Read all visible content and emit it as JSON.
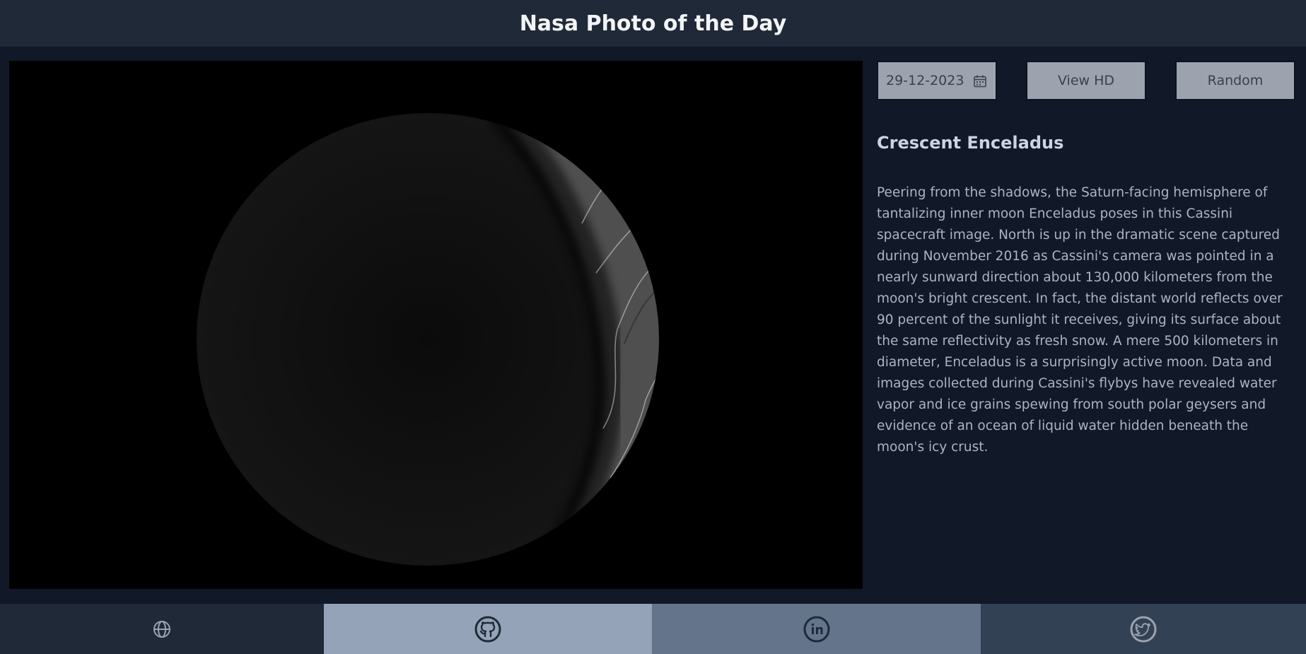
{
  "header": {
    "title": "Nasa Photo of the Day"
  },
  "controls": {
    "date_value": "29-12-2023",
    "view_hd_label": "View HD",
    "random_label": "Random"
  },
  "photo": {
    "title": "Crescent Enceladus",
    "description": "Peering from the shadows, the Saturn-facing hemisphere of tantalizing inner moon Enceladus poses in this Cassini spacecraft image. North is up in the dramatic scene captured during November 2016 as Cassini's camera was pointed in a nearly sunward direction about 130,000 kilometers from the moon's bright crescent. In fact, the distant world reflects over 90 percent of the sunlight it receives, giving its surface about the same reflectivity as fresh snow. A mere 500 kilometers in diameter, Enceladus is a surprisingly active moon. Data and images collected during Cassini's flybys have revealed water vapor and ice grains spewing from south polar geysers and evidence of an ocean of liquid water hidden beneath the moon's icy crust."
  },
  "footer": {
    "links": [
      {
        "icon": "globe-icon",
        "color": "#1f2937"
      },
      {
        "icon": "github-icon",
        "color": "#94a3b8"
      },
      {
        "icon": "linkedin-icon",
        "color": "#64748b"
      },
      {
        "icon": "twitter-icon",
        "color": "#334155"
      }
    ]
  },
  "colors": {
    "background": "#111827",
    "header_bg": "#1f2937",
    "button_bg": "#9ca3af"
  }
}
